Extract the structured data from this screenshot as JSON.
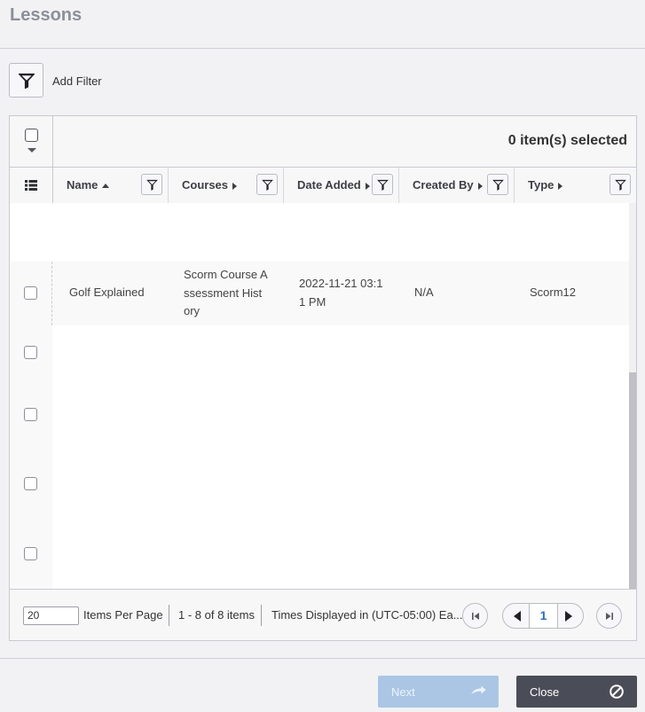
{
  "dialog": {
    "title": "Lessons",
    "add_filter_label": "Add Filter"
  },
  "grid": {
    "selected_count_text": "0 item(s) selected",
    "columns": [
      {
        "label": "Name",
        "sort": "ascending"
      },
      {
        "label": "Courses",
        "sort": "none"
      },
      {
        "label": "Date Added",
        "sort": "none"
      },
      {
        "label": "Created By",
        "sort": "none"
      },
      {
        "label": "Type",
        "sort": "none"
      }
    ],
    "rows": [
      {
        "name": "Golf Explained",
        "courses": [
          "Scorm Course A",
          "ssessment Hist",
          "ory"
        ],
        "date_added": [
          "2022-11-21 03:1",
          "1 PM"
        ],
        "created_by": "N/A",
        "type": "Scorm12",
        "checked": false
      }
    ]
  },
  "pager": {
    "page_size": "20",
    "items_per_page_label": "Items Per Page",
    "range_text": "1 - 8 of 8 items",
    "timezone_text": "Times Displayed in (UTC-05:00) Ea...",
    "current_page": "1"
  },
  "footer": {
    "next_label": "Next",
    "close_label": "Close"
  },
  "icons": {
    "filter": "funnel-icon",
    "column_menu": "list-icon",
    "first": "first-page-icon",
    "prev": "prev-page-icon",
    "next_page": "next-page-icon",
    "last": "last-page-icon",
    "next_button": "arrow-right-icon",
    "close_button": "cancel-icon"
  },
  "colors": {
    "accent": "#2a6ebb",
    "next_button_bg": "#aac6e4",
    "close_button_bg": "#4a4d57"
  }
}
